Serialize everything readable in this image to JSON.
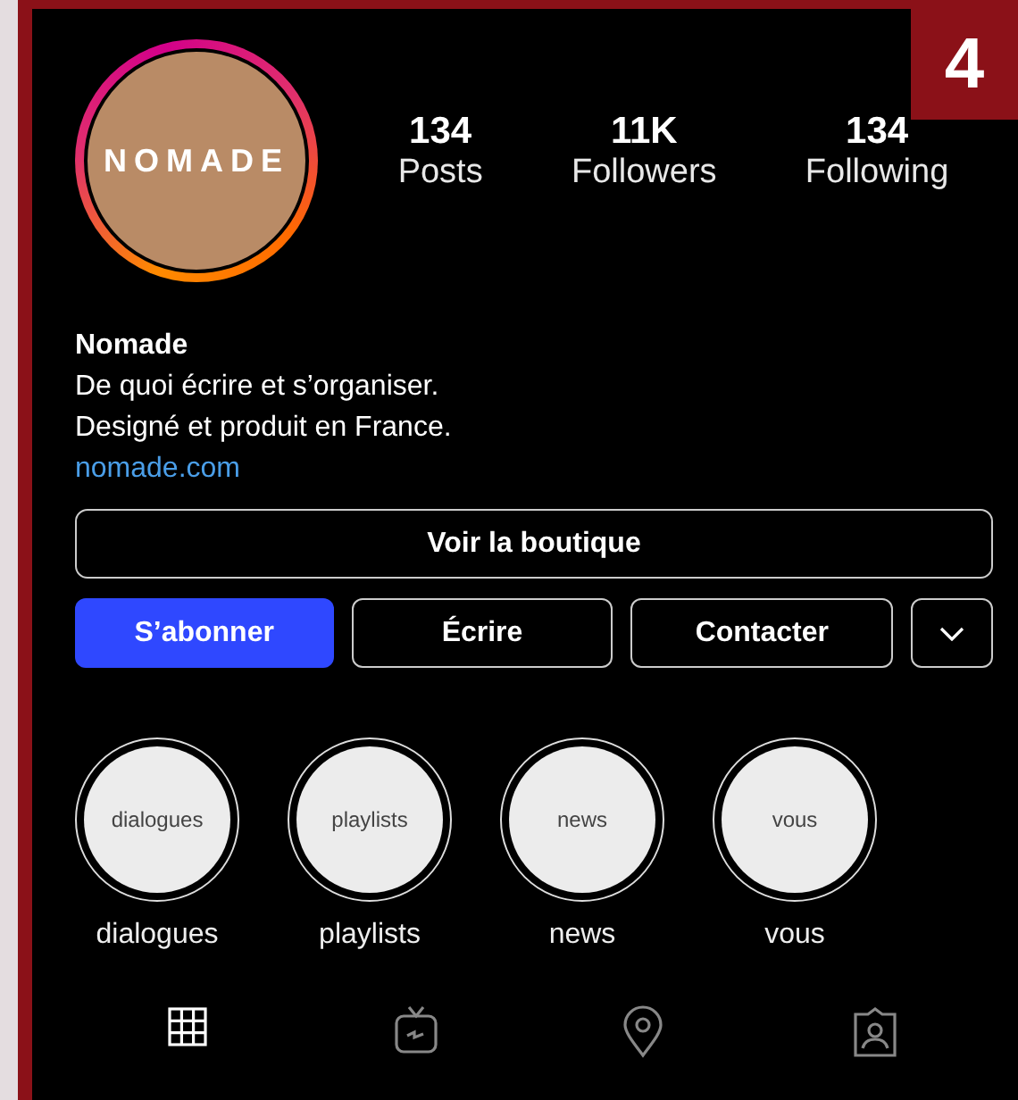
{
  "badge": "4",
  "profile": {
    "avatar_text": "NOMADE",
    "stats": [
      {
        "value": "134",
        "label": "Posts"
      },
      {
        "value": "11K",
        "label": "Followers"
      },
      {
        "value": "134",
        "label": "Following"
      }
    ]
  },
  "bio": {
    "name": "Nomade",
    "lines": [
      "De quoi écrire et s’organiser.",
      "Designé et produit en France."
    ],
    "link": "nomade.com"
  },
  "shop_button": "Voir la boutique",
  "actions": [
    {
      "label": "S’abonner",
      "kind": "primary"
    },
    {
      "label": "Écrire",
      "kind": "outline"
    },
    {
      "label": "Contacter",
      "kind": "outline"
    },
    {
      "kind": "dropdown"
    }
  ],
  "highlights": [
    {
      "cover_label": "dialogues",
      "label": "dialogues"
    },
    {
      "cover_label": "playlists",
      "label": "playlists"
    },
    {
      "cover_label": "news",
      "label": "news"
    },
    {
      "cover_label": "vous",
      "label": "vous"
    }
  ],
  "tabs": [
    {
      "kind": "grid",
      "selected": true
    },
    {
      "kind": "tv",
      "selected": false
    },
    {
      "kind": "location",
      "selected": false
    },
    {
      "kind": "tagged",
      "selected": false
    }
  ]
}
